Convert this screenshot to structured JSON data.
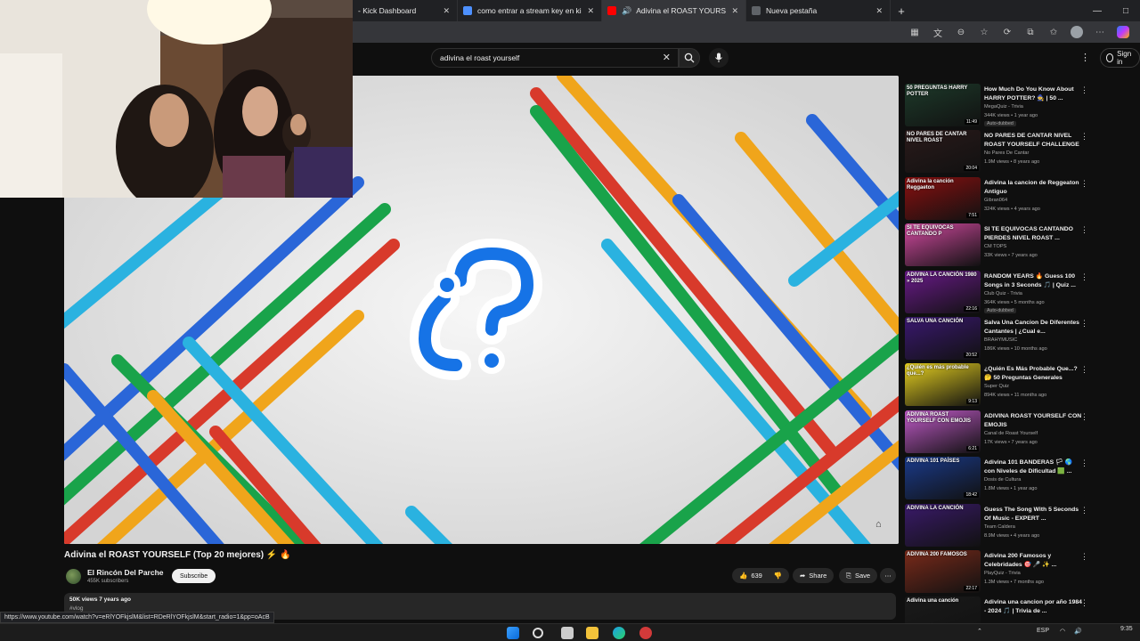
{
  "browser": {
    "tabs": [
      {
        "title": "- Kick Dashboard",
        "favicon_color": "#53fc18"
      },
      {
        "title": "como entrar a stream key en kick",
        "favicon_color": "#4d90fe"
      },
      {
        "title": "Adivina el ROAST YOURSELF",
        "favicon_color": "#ff0000"
      },
      {
        "title": "Nueva pestaña",
        "favicon_color": "#5f6368"
      }
    ],
    "active_tab": 2,
    "new_tab_label": "+",
    "window_controls": [
      "—",
      "□"
    ]
  },
  "youtube": {
    "search": {
      "query": "adivina el roast yourself"
    },
    "signin_label": "Sign in",
    "video": {
      "title": "Adivina el ROAST YOURSELF (Top 20 mejores) ⚡ 🔥",
      "channel_name": "El Rincón Del Parche",
      "subscribers": "455K subscribers",
      "subscribe_label": "Subscribe",
      "likes": "639",
      "share_label": "Share",
      "save_label": "Save",
      "views_date": "50K views  7 years ago",
      "hashtag": "#vlog"
    },
    "colors": {
      "bg": "#0f0f0f",
      "pill": "#272727",
      "text": "#f1f1f1",
      "muted": "#aaaaaa"
    },
    "recommendations": [
      {
        "title": "How Much Do You Know About HARRY POTTER? 🧙 | 50 ...",
        "channel": "MegaQuiz - Trivia",
        "meta": "344K views • 1 year ago",
        "badge": "Auto-dubbed",
        "thumb_text": "50 PREGUNTAS HARRY POTTER",
        "duration": "11:49",
        "thumb_color": "#1d3a2a"
      },
      {
        "title": "NO PARES DE CANTAR  NIVEL ROAST YOURSELF CHALLENGE",
        "channel": "No Pares De Cantar",
        "meta": "1.9M views • 8 years ago",
        "badge": "",
        "thumb_text": "NO PARES DE CANTAR NIVEL ROAST",
        "duration": "20:04",
        "thumb_color": "#2a1a1a"
      },
      {
        "title": "Adivina la cancion de Reggeaton Antiguo",
        "channel": "Gibran064",
        "meta": "324K views • 4 years ago",
        "badge": "",
        "thumb_text": "Adivina la canción Reggaeton",
        "duration": "7:51",
        "thumb_color": "#8a1010"
      },
      {
        "title": "SI TE EQUIVOCAS CANTANDO PIERDES NIVEL ROAST ...",
        "channel": "CM TOPS",
        "meta": "33K views • 7 years ago",
        "badge": "",
        "thumb_text": "SI TE EQUIVOCAS CANTANDO P",
        "duration": "",
        "thumb_color": "#d24aa0"
      },
      {
        "title": "RANDOM YEARS 🔥 Guess 100 Songs in 3 Seconds 🎵 | Quiz ...",
        "channel": "Club Quiz - Trivia",
        "meta": "364K views • 5 months ago",
        "badge": "Auto-dubbed",
        "thumb_text": "ADIVINA LA CANCIÓN 1980 » 2025",
        "duration": "22:16",
        "thumb_color": "#6a1a8a"
      },
      {
        "title": "Salva Una Cancion De Diferentes Cantantes | ¿Cual e...",
        "channel": "BRAHYMUSIC",
        "meta": "186K views • 10 months ago",
        "badge": "",
        "thumb_text": "SALVA UNA CANCIÓN",
        "duration": "20:52",
        "thumb_color": "#3a1870"
      },
      {
        "title": "¿Quién Es Más Probable Que...? 🤔 50 Preguntas Generales",
        "channel": "Super Quiz",
        "meta": "894K views • 11 months ago",
        "badge": "",
        "thumb_text": "¿Quién es más probable que...?",
        "duration": "9:13",
        "thumb_color": "#e6d020"
      },
      {
        "title": "ADIVINA ROAST YOURSELF CON EMOJIS",
        "channel": "Canal de Roast Yourself",
        "meta": "17K views • 7 years ago",
        "badge": "",
        "thumb_text": "ADIVINA ROAST YOURSELF CON EMOJIS",
        "duration": "6:21",
        "thumb_color": "#c05ac8"
      },
      {
        "title": "Adivina 101 BANDERAS 🏳 🌎 con Niveles de Dificultad 🟩 ...",
        "channel": "Dosis de Cultura",
        "meta": "1.8M views • 1 year ago",
        "badge": "",
        "thumb_text": "ADIVINA 101 PAÍSES",
        "duration": "18:42",
        "thumb_color": "#1a3a8a"
      },
      {
        "title": "Guess The Song With 5 Seconds Of Music - EXPERT ...",
        "channel": "Team Caldera",
        "meta": "8.9M views • 4 years ago",
        "badge": "",
        "thumb_text": "ADIVINA LA CANCIÓN",
        "duration": "",
        "thumb_color": "#3a1a6a"
      },
      {
        "title": "Adivina 200 Famosos y Celebridades 🎯 🎤 ✨ ...",
        "channel": "PlayQuiz - Trivia",
        "meta": "1.3M views • 7 months ago",
        "badge": "",
        "thumb_text": "ADIVINA 200 FAMOSOS",
        "duration": "22:17",
        "thumb_color": "#7a2a1a"
      },
      {
        "title": "Adivina una cancion por año 1984 - 2024 🎵 | Trivia de ...",
        "channel": "",
        "meta": "",
        "badge": "",
        "thumb_text": "Adivina una canción",
        "duration": "",
        "thumb_color": "#1a1a1a"
      }
    ]
  },
  "status_url": "https://www.youtube.com/watch?v=eRlYOFkjslM&list=RDeRlYOFkjslM&start_radio=1&pp=oAcB",
  "taskbar": {
    "language": "ESP",
    "time": "9:35"
  }
}
